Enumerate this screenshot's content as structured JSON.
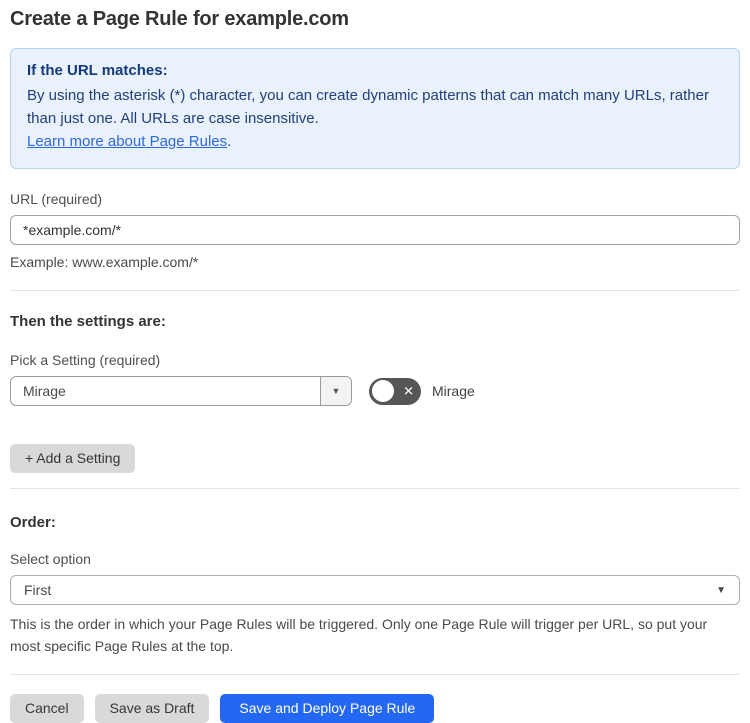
{
  "page": {
    "title": "Create a Page Rule for example.com"
  },
  "info_box": {
    "heading": "If the URL matches:",
    "body": "By using the asterisk (*) character, you can create dynamic patterns that can match many URLs, rather than just one. All URLs are case insensitive.",
    "link_label": "Learn more about Page Rules",
    "link_suffix": "."
  },
  "url_field": {
    "label": "URL (required)",
    "value": "*example.com/*",
    "example": "Example: www.example.com/*"
  },
  "settings_section": {
    "heading": "Then the settings are:",
    "pick_setting_label": "Pick a Setting (required)",
    "selected_setting": "Mirage",
    "toggle_label": "Mirage",
    "toggle_state": "off",
    "add_setting_button": "+ Add a Setting"
  },
  "order_section": {
    "heading": "Order:",
    "select_label": "Select option",
    "selected_option": "First",
    "help_text": "This is the order in which your Page Rules will be triggered. Only one Page Rule will trigger per URL, so put your most specific Page Rules at the top."
  },
  "actions": {
    "cancel": "Cancel",
    "save_draft": "Save as Draft",
    "save_deploy": "Save and Deploy Page Rule"
  },
  "icons": {
    "dropdown_arrow": "▼",
    "select_arrow": "▼",
    "toggle_x": "✕"
  },
  "colors": {
    "info_bg": "#e8f1fc",
    "info_border": "#b6d3f2",
    "info_heading_text": "#16397c",
    "info_body_text": "#24407a",
    "link": "#3168d9",
    "primary_button": "#2467f2",
    "secondary_button": "#d9d9d9",
    "toggle_off_bg": "#545657",
    "divider": "#e4e4e4"
  }
}
